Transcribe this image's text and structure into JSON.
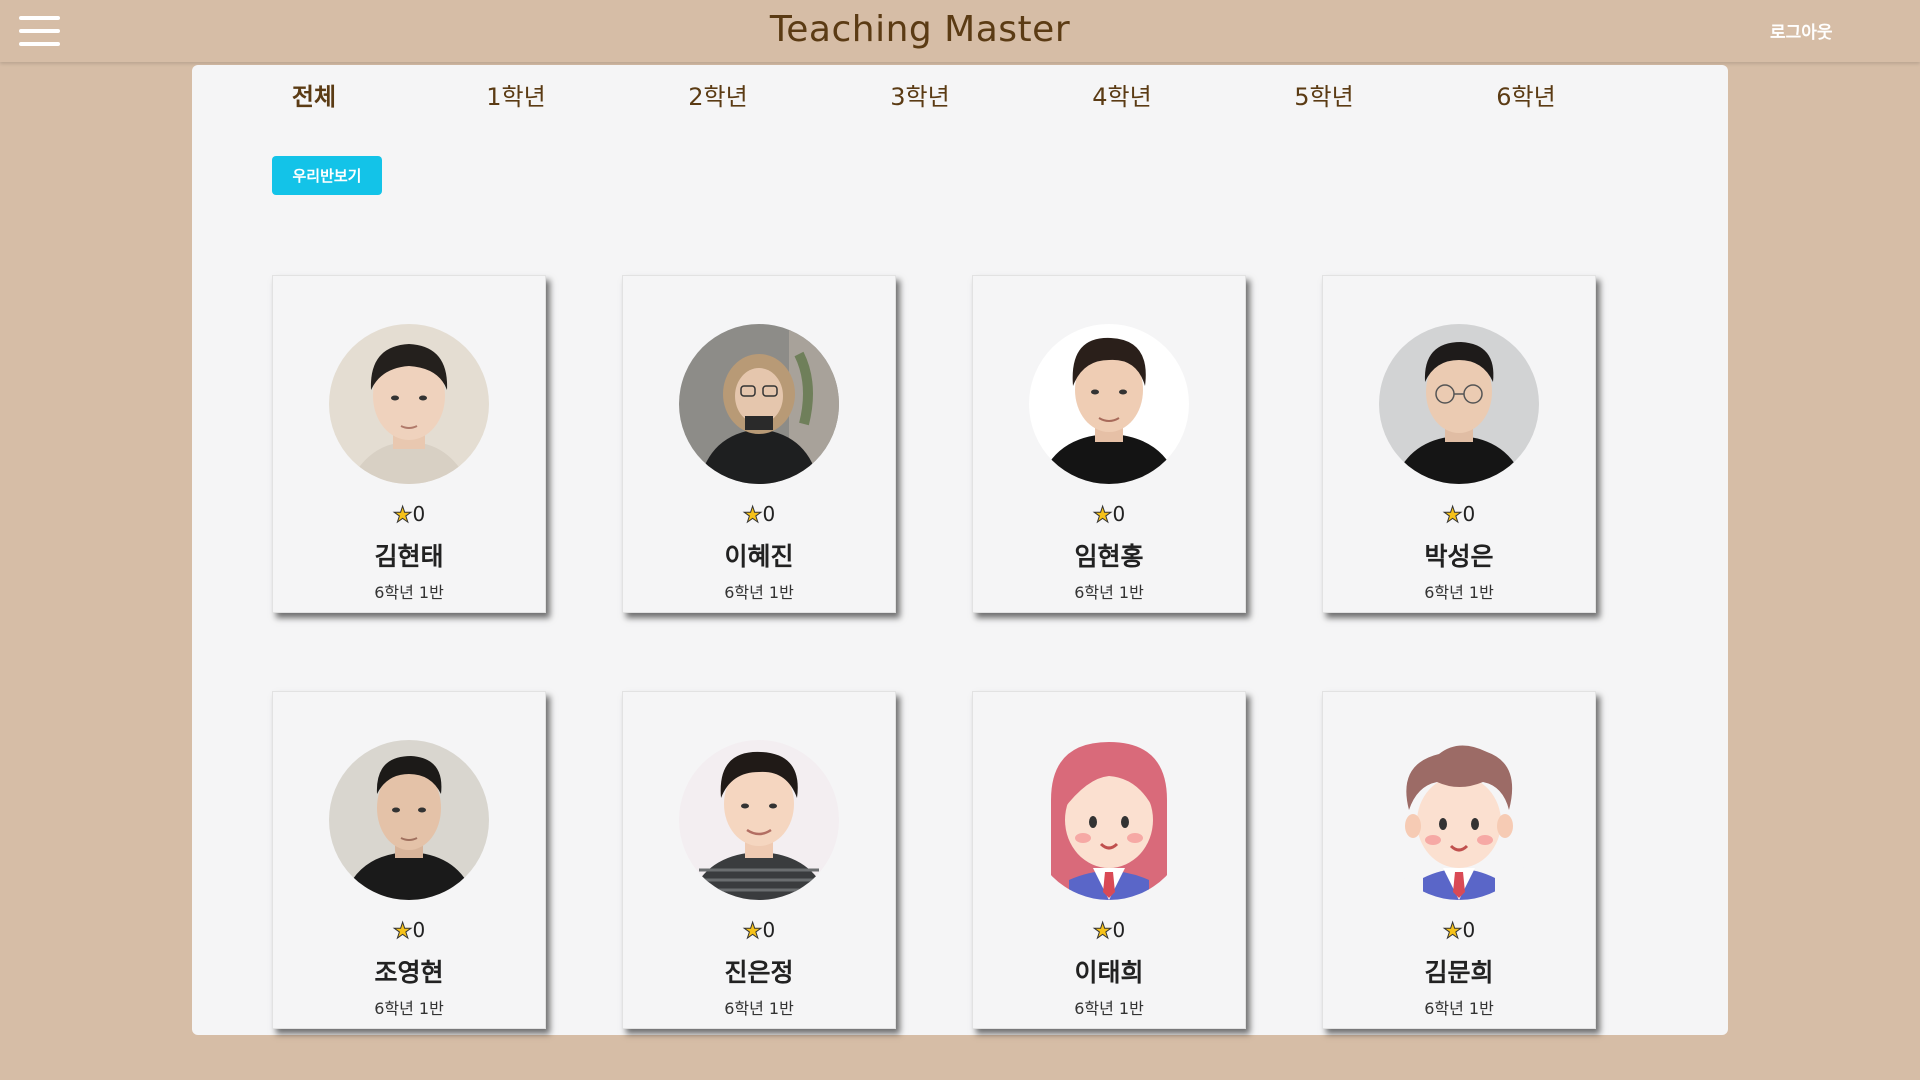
{
  "header": {
    "title": "Teaching Master",
    "logout_label": "로그아웃"
  },
  "tabs": [
    {
      "label": "전체",
      "active": true
    },
    {
      "label": "1학년",
      "active": false
    },
    {
      "label": "2학년",
      "active": false
    },
    {
      "label": "3학년",
      "active": false
    },
    {
      "label": "4학년",
      "active": false
    },
    {
      "label": "5학년",
      "active": false
    },
    {
      "label": "6학년",
      "active": false
    }
  ],
  "our_class_button": "우리반보기",
  "students": [
    {
      "name": "김현태",
      "stars": "0",
      "class": "6학년 1반",
      "avatar": "photo-boy"
    },
    {
      "name": "이혜진",
      "stars": "0",
      "class": "6학년 1반",
      "avatar": "photo-winter"
    },
    {
      "name": "임현홍",
      "stars": "0",
      "class": "6학년 1반",
      "avatar": "photo-boy"
    },
    {
      "name": "박성은",
      "stars": "0",
      "class": "6학년 1반",
      "avatar": "photo-glasses"
    },
    {
      "name": "조영현",
      "stars": "0",
      "class": "6학년 1반",
      "avatar": "photo-boy"
    },
    {
      "name": "진은정",
      "stars": "0",
      "class": "6학년 1반",
      "avatar": "photo-stripe"
    },
    {
      "name": "이태희",
      "stars": "0",
      "class": "6학년 1반",
      "avatar": "cartoon-girl"
    },
    {
      "name": "김문희",
      "stars": "0",
      "class": "6학년 1반",
      "avatar": "cartoon-boy"
    }
  ],
  "colors": {
    "background": "#d6bda6",
    "panel": "#f5f5f6",
    "accent": "#13c3e8",
    "title": "#5b3b14"
  }
}
